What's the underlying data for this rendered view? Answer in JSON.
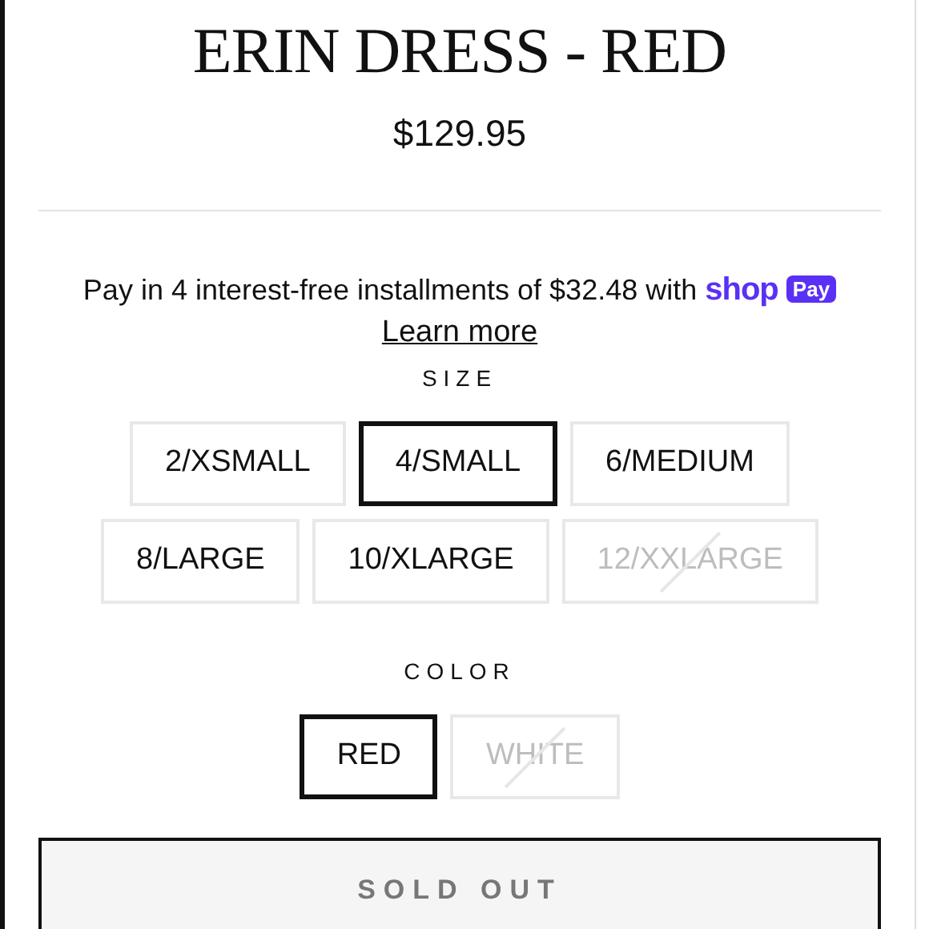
{
  "product": {
    "title": "ERIN DRESS - RED",
    "price": "$129.95"
  },
  "installments": {
    "text": "Pay in 4 interest-free installments of $32.48 with",
    "brand_shop": "shop",
    "brand_pay": "Pay",
    "link": "Learn more"
  },
  "size": {
    "label": "SIZE",
    "options": [
      {
        "label": "2/XSMALL",
        "selected": false,
        "disabled": false
      },
      {
        "label": "4/SMALL",
        "selected": true,
        "disabled": false
      },
      {
        "label": "6/MEDIUM",
        "selected": false,
        "disabled": false
      },
      {
        "label": "8/LARGE",
        "selected": false,
        "disabled": false
      },
      {
        "label": "10/XLARGE",
        "selected": false,
        "disabled": false
      },
      {
        "label": "12/XXLARGE",
        "selected": false,
        "disabled": true
      }
    ]
  },
  "color": {
    "label": "COLOR",
    "options": [
      {
        "label": "RED",
        "selected": true,
        "disabled": false
      },
      {
        "label": "WHITE",
        "selected": false,
        "disabled": true
      }
    ]
  },
  "buy_button": {
    "label": "SOLD OUT",
    "disabled": true
  }
}
